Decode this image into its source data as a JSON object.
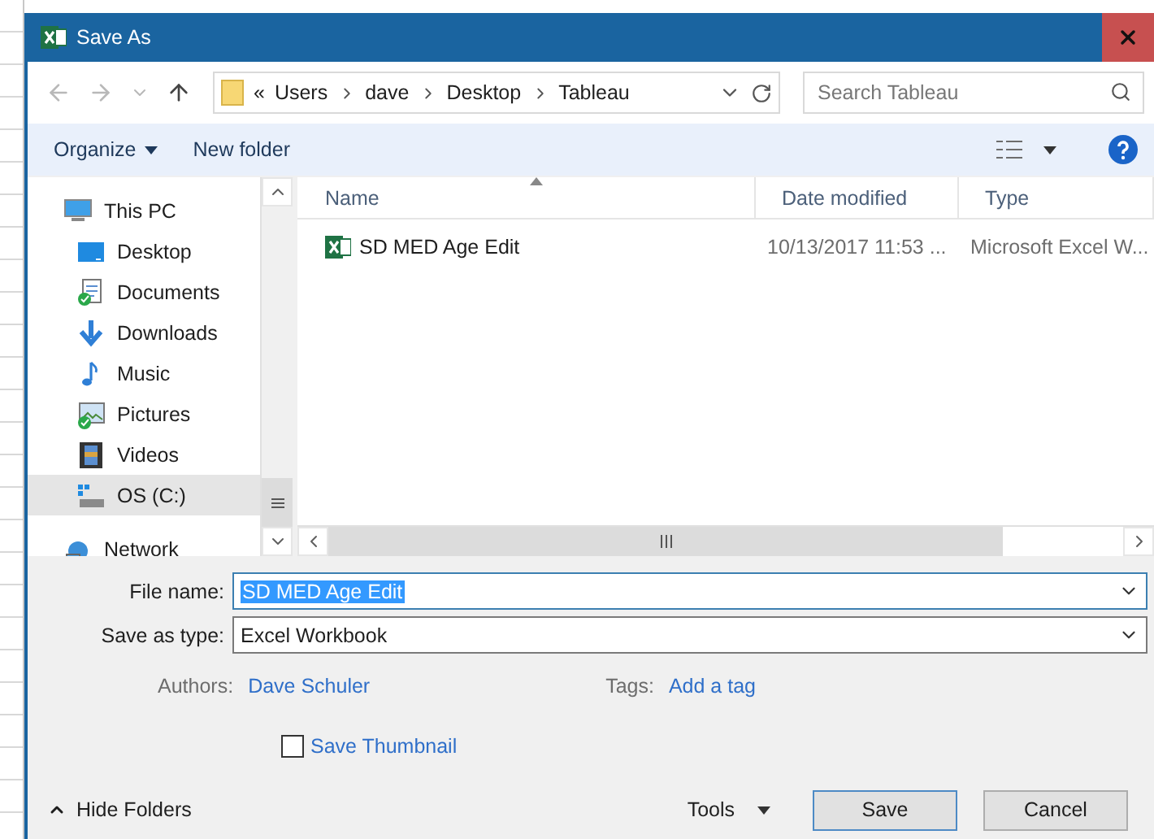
{
  "window": {
    "title": "Save As"
  },
  "address_bar": {
    "overflow": "«",
    "path": [
      "Users",
      "dave",
      "Desktop",
      "Tableau"
    ]
  },
  "search": {
    "placeholder": "Search Tableau"
  },
  "toolbar": {
    "organize": "Organize",
    "new_folder": "New folder"
  },
  "nav": {
    "items": [
      {
        "label": "This PC",
        "kind": "pc",
        "selected": false,
        "children": [
          {
            "label": "Desktop",
            "kind": "desktop",
            "selected": false
          },
          {
            "label": "Documents",
            "kind": "documents",
            "selected": false
          },
          {
            "label": "Downloads",
            "kind": "downloads",
            "selected": false
          },
          {
            "label": "Music",
            "kind": "music",
            "selected": false
          },
          {
            "label": "Pictures",
            "kind": "pictures",
            "selected": false
          },
          {
            "label": "Videos",
            "kind": "videos",
            "selected": false
          },
          {
            "label": "OS (C:)",
            "kind": "drive",
            "selected": true
          }
        ]
      },
      {
        "label": "Network",
        "kind": "network",
        "selected": false
      }
    ]
  },
  "table": {
    "columns": [
      "Name",
      "Date modified",
      "Type"
    ],
    "rows": [
      {
        "cells": [
          "SD MED Age Edit",
          "10/13/2017 11:53 ...",
          "Microsoft Excel W..."
        ]
      }
    ]
  },
  "form": {
    "file_name": {
      "label": "File name:",
      "value": "SD MED Age Edit"
    },
    "save_as_type": {
      "label": "Save as type:",
      "value": "Excel Workbook"
    },
    "authors": {
      "label": "Authors:",
      "value": "Dave Schuler"
    },
    "tags": {
      "label": "Tags:",
      "value": "Add a tag"
    },
    "save_thumbnail": {
      "label": "Save Thumbnail",
      "checked": false
    }
  },
  "footer": {
    "hide_folders": "Hide Folders",
    "tools": "Tools",
    "buttons": [
      "Save",
      "Cancel"
    ]
  }
}
